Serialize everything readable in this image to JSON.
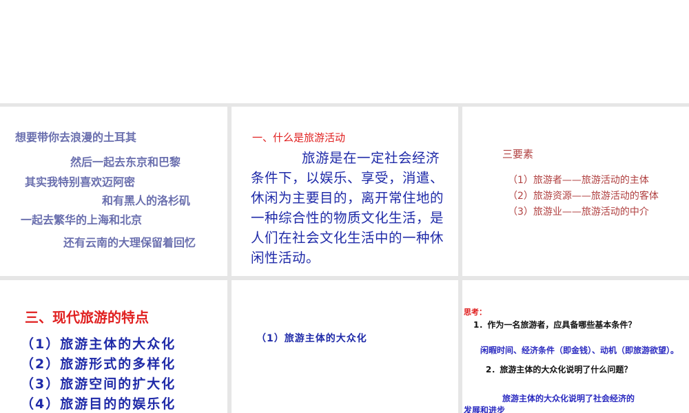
{
  "slide1": {
    "lyrics": [
      "想要带你去浪漫的土耳其",
      "然后一起去东京和巴黎",
      "其实我特别喜欢迈阿密",
      "和有黑人的洛杉矶",
      "一起去繁华的上海和北京",
      "还有云南的大理保留着回忆"
    ]
  },
  "slide2": {
    "heading": "一、什么是旅游活动",
    "body": "旅游是在一定社会经济条件下，以娱乐、享受，消遣、休闲为主要目的，离开常住地的一种综合性的物质文化生活，是人们在社会文化生活中的一种休闲性活动。"
  },
  "slide3": {
    "title": "三要素",
    "items": [
      "（1）旅游者——旅游活动的主体",
      "（2）旅游资源——旅游活动的客体",
      "（3）旅游业——旅游活动的中介"
    ]
  },
  "slide4": {
    "title": "三、现代旅游的特点",
    "items": [
      "（1）旅游主体的大众化",
      "（2）旅游形式的多样化",
      "（3）旅游空间的扩大化",
      "（4）旅游目的的娱乐化"
    ]
  },
  "slide5": {
    "item": "（1）旅游主体的大众化"
  },
  "slide6": {
    "label": "思考：",
    "q1": "1．作为一名旅游者，应具备哪些基本条件？",
    "a1": "闲暇时间、经济条件（即金钱）、动机（即旅游欲望）。",
    "q2": "2．旅游主体的大众化说明了什么问题？",
    "a2_line1": "旅游主体的大众化说明了社会经济的",
    "a2_line2": "发展和进步"
  }
}
